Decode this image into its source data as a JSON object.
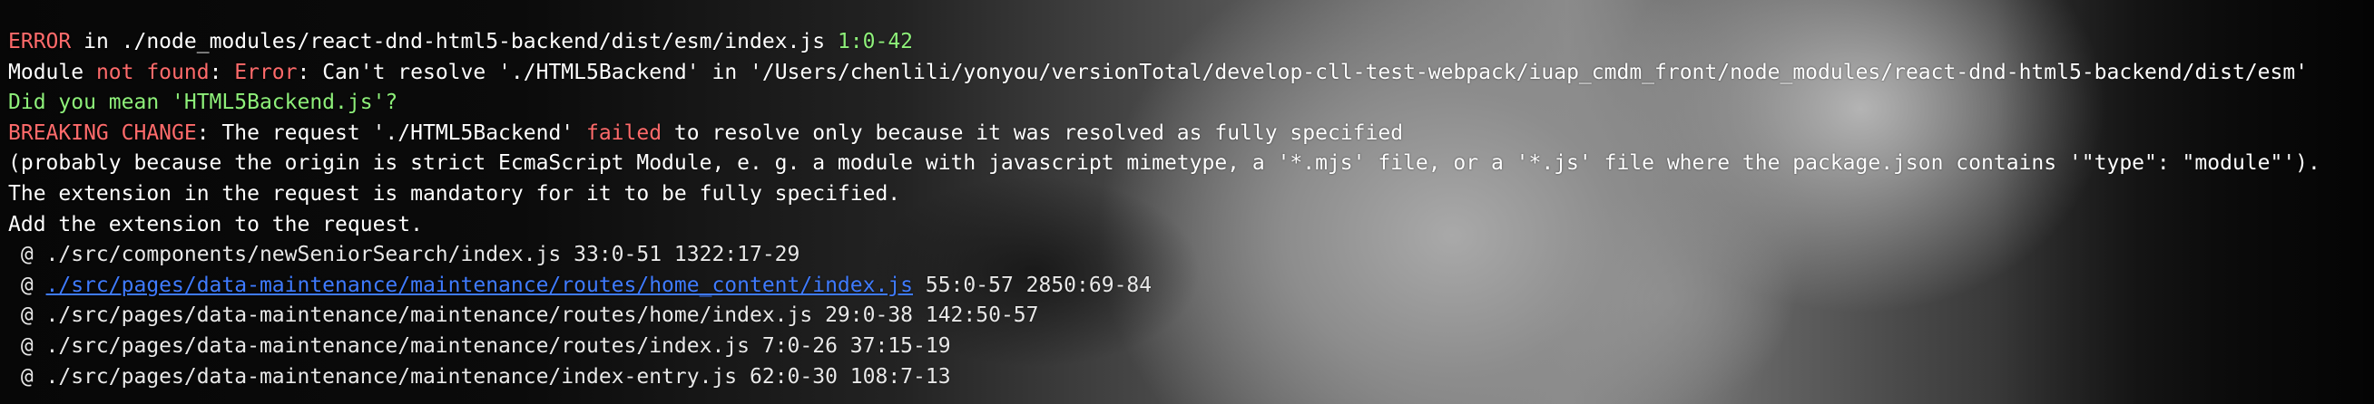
{
  "terminal": {
    "line1": {
      "error": "ERROR",
      "in": " in ",
      "file": "./node_modules/react-dnd-html5-backend/dist/esm/index.js",
      "position": " 1:0-42"
    },
    "line2": {
      "module": "Module ",
      "not_found": "not found",
      "colon": ": ",
      "error_word": "Error",
      "message": ": Can't resolve './HTML5Backend' in '/Users/chenlili/yonyou/versionTotal/develop-cll-test-webpack/iuap_cmdm_front/node_modules/react-dnd-html5-backend/dist/esm'"
    },
    "line3": "Did you mean 'HTML5Backend.js'?",
    "line4": {
      "breaking": "BREAKING CHANGE",
      "before": ": The request './HTML5Backend' ",
      "failed": "failed",
      "after": " to resolve only because it was resolved as fully specified"
    },
    "line5": "(probably because the origin is strict EcmaScript Module, e. g. a module with javascript mimetype, a '*.mjs' file, or a '*.js' file where the package.json contains '\"type\": \"module\"').",
    "line6": "The extension in the request is mandatory for it to be fully specified.",
    "line7": "Add the extension to the request.",
    "stack": [
      {
        "prefix": " @ ",
        "path": "./src/components/newSeniorSearch/index.js",
        "location": " 33:0-51 1322:17-29",
        "link": false
      },
      {
        "prefix": " @ ",
        "path": "./src/pages/data-maintenance/maintenance/routes/home_content/index.js",
        "location": " 55:0-57 2850:69-84",
        "link": true
      },
      {
        "prefix": " @ ",
        "path": "./src/pages/data-maintenance/maintenance/routes/home/index.js",
        "location": " 29:0-38 142:50-57",
        "link": false
      },
      {
        "prefix": " @ ",
        "path": "./src/pages/data-maintenance/maintenance/routes/index.js",
        "location": " 7:0-26 37:15-19",
        "link": false
      },
      {
        "prefix": " @ ",
        "path": "./src/pages/data-maintenance/maintenance/index-entry.js",
        "location": " 62:0-30 108:7-13",
        "link": false
      }
    ]
  }
}
